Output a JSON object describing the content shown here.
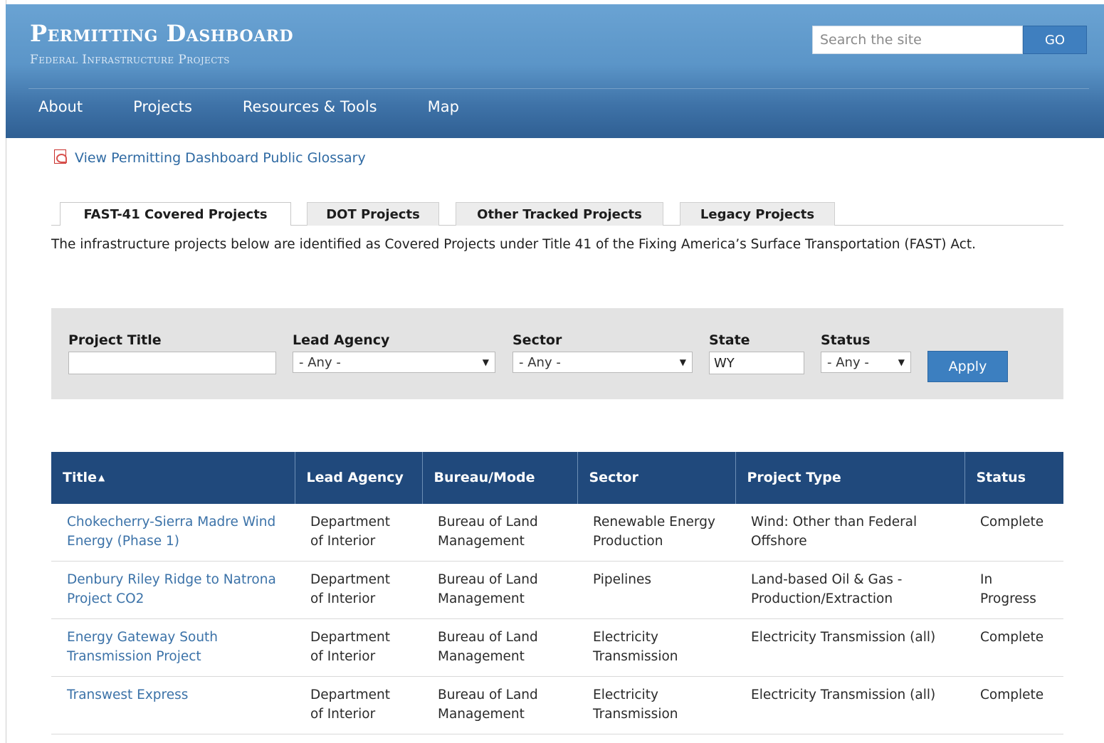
{
  "header": {
    "title": "Permitting Dashboard",
    "subtitle": "Federal Infrastructure Projects",
    "search_placeholder": "Search the site",
    "go_label": "GO"
  },
  "nav": {
    "items": [
      "About",
      "Projects",
      "Resources & Tools",
      "Map"
    ]
  },
  "glossary": {
    "icon": "pdf-icon",
    "label": "View Permitting Dashboard Public Glossary"
  },
  "tabs": [
    {
      "label": "FAST-41 Covered Projects",
      "active": true
    },
    {
      "label": "DOT Projects",
      "active": false
    },
    {
      "label": "Other Tracked Projects",
      "active": false
    },
    {
      "label": "Legacy Projects",
      "active": false
    }
  ],
  "intro": "The infrastructure projects below are identified as Covered Projects under Title 41 of the Fixing America’s Surface Transportation (FAST) Act.",
  "filters": {
    "project_title": {
      "label": "Project Title",
      "value": ""
    },
    "lead_agency": {
      "label": "Lead Agency",
      "value": "- Any -"
    },
    "sector": {
      "label": "Sector",
      "value": "- Any -"
    },
    "state": {
      "label": "State",
      "value": "WY"
    },
    "status": {
      "label": "Status",
      "value": "- Any -"
    },
    "apply_label": "Apply"
  },
  "table": {
    "headers": [
      "Title",
      "Lead Agency",
      "Bureau/Mode",
      "Sector",
      "Project Type",
      "Status"
    ],
    "sort_indicator": "▲",
    "rows": [
      [
        "Chokecherry-Sierra Madre Wind Energy (Phase 1)",
        "Department of Interior",
        "Bureau of Land Management",
        "Renewable Energy Production",
        "Wind: Other than Federal Offshore",
        "Complete"
      ],
      [
        "Denbury Riley Ridge to Natrona Project CO2",
        "Department of Interior",
        "Bureau of Land Management",
        "Pipelines",
        "Land-based Oil & Gas - Production/Extraction",
        "In Progress"
      ],
      [
        "Energy Gateway South Transmission Project",
        "Department of Interior",
        "Bureau of Land Management",
        "Electricity Transmission",
        "Electricity Transmission (all)",
        "Complete"
      ],
      [
        "Transwest Express",
        "Department of Interior",
        "Bureau of Land Management",
        "Electricity Transmission",
        "Electricity Transmission (all)",
        "Complete"
      ]
    ]
  }
}
